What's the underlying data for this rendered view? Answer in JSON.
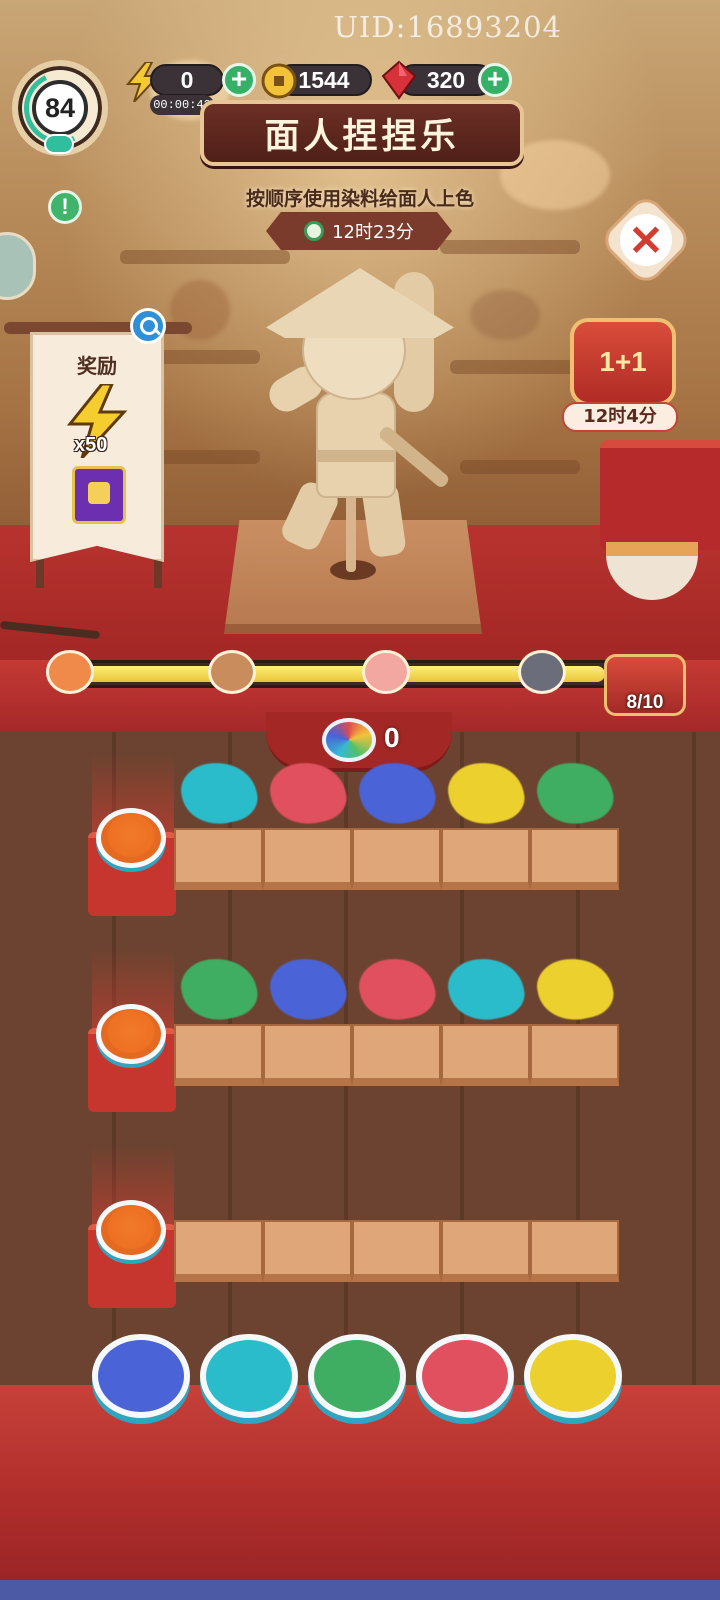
{
  "header": {
    "uid": "UID:16893204",
    "level": "84",
    "energy": {
      "value": "0",
      "timer": "00:00:42"
    },
    "coins": "1544",
    "gems": "320"
  },
  "game": {
    "title": "面人捏捏乐",
    "instruction": "按顺序使用染料给面人上色",
    "event_timer": "12时23分"
  },
  "reward": {
    "label": "奖励",
    "energy_quantity": "x50"
  },
  "side_box": {
    "label": "1+1",
    "timer": "12时4分"
  },
  "progress": {
    "filled_fraction": 0.98,
    "chest_count": "8/10"
  },
  "mixed_dye": {
    "count": "0"
  },
  "colors": {
    "blue": "#4a63d6",
    "cyan": "#2bbccc",
    "green": "#3fae62",
    "red": "#e0505e",
    "yellow": "#ecd12e",
    "orange": "#ee7023"
  },
  "rows": [
    {
      "bowl_color": "orange",
      "sequence": [
        "cyan",
        "red",
        "blue",
        "yellow",
        "green"
      ]
    },
    {
      "bowl_color": "orange",
      "sequence": [
        "green",
        "blue",
        "red",
        "cyan",
        "yellow"
      ]
    },
    {
      "bowl_color": "orange",
      "sequence": []
    }
  ],
  "paint_bowls": [
    "blue",
    "cyan",
    "green",
    "red",
    "yellow"
  ],
  "icons": [
    "energy-bolt-icon",
    "coin-icon",
    "gem-icon",
    "plus-icon",
    "close-icon",
    "search-icon",
    "alert-icon",
    "leaf-icon",
    "chest-icon"
  ]
}
